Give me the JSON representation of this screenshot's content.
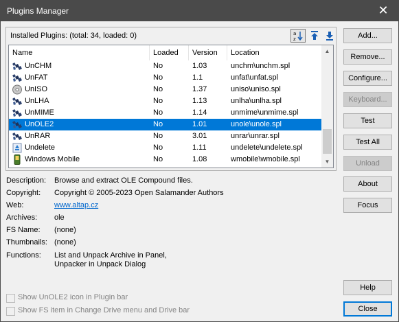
{
  "window": {
    "title": "Plugins Manager"
  },
  "installed": {
    "label": "Installed Plugins: (total: 34, loaded: 0)"
  },
  "columns": {
    "name": "Name",
    "loaded": "Loaded",
    "version": "Version",
    "location": "Location"
  },
  "plugins": [
    {
      "name": "UnCHM",
      "loaded": "No",
      "version": "1.03",
      "location": "unchm\\unchm.spl",
      "icon": "archive-icon"
    },
    {
      "name": "UnFAT",
      "loaded": "No",
      "version": "1.1",
      "location": "unfat\\unfat.spl",
      "icon": "archive-icon"
    },
    {
      "name": "UnISO",
      "loaded": "No",
      "version": "1.37",
      "location": "uniso\\uniso.spl",
      "icon": "disc-icon"
    },
    {
      "name": "UnLHA",
      "loaded": "No",
      "version": "1.13",
      "location": "unlha\\unlha.spl",
      "icon": "archive-icon"
    },
    {
      "name": "UnMIME",
      "loaded": "No",
      "version": "1.14",
      "location": "unmime\\unmime.spl",
      "icon": "archive-icon"
    },
    {
      "name": "UnOLE2",
      "loaded": "No",
      "version": "1.01",
      "location": "unole\\unole.spl",
      "icon": "archive-icon"
    },
    {
      "name": "UnRAR",
      "loaded": "No",
      "version": "3.01",
      "location": "unrar\\unrar.spl",
      "icon": "archive-icon"
    },
    {
      "name": "Undelete",
      "loaded": "No",
      "version": "1.11",
      "location": "undelete\\undelete.spl",
      "icon": "recycle-icon"
    },
    {
      "name": "Windows Mobile",
      "loaded": "No",
      "version": "1.08",
      "location": "wmobile\\wmobile.spl",
      "icon": "mobile-icon"
    }
  ],
  "selected_plugin": "UnOLE2",
  "buttons": {
    "add": "Add...",
    "remove": "Remove...",
    "configure": "Configure...",
    "keyboard": "Keyboard...",
    "test": "Test",
    "test_all": "Test All",
    "unload": "Unload",
    "about": "About",
    "focus": "Focus",
    "help": "Help",
    "close": "Close"
  },
  "details": {
    "description_label": "Description:",
    "description": "Browse and extract OLE Compound files.",
    "copyright_label": "Copyright:",
    "copyright": "Copyright © 2005-2023 Open Salamander Authors",
    "web_label": "Web:",
    "web": "www.altap.cz",
    "archives_label": "Archives:",
    "archives": "ole",
    "fsname_label": "FS Name:",
    "fsname": "(none)",
    "thumbnails_label": "Thumbnails:",
    "thumbnails": "(none)",
    "functions_label": "Functions:",
    "functions_line1": "List and Unpack Archive in Panel,",
    "functions_line2": "Unpacker in Unpack Dialog"
  },
  "checkboxes": {
    "show_icon": "Show UnOLE2 icon in Plugin bar",
    "show_fs": "Show FS item in Change Drive menu and Drive bar"
  },
  "colors": {
    "selection": "#0078d7",
    "titlebar": "#4a4a4a",
    "link": "#0066cc"
  }
}
